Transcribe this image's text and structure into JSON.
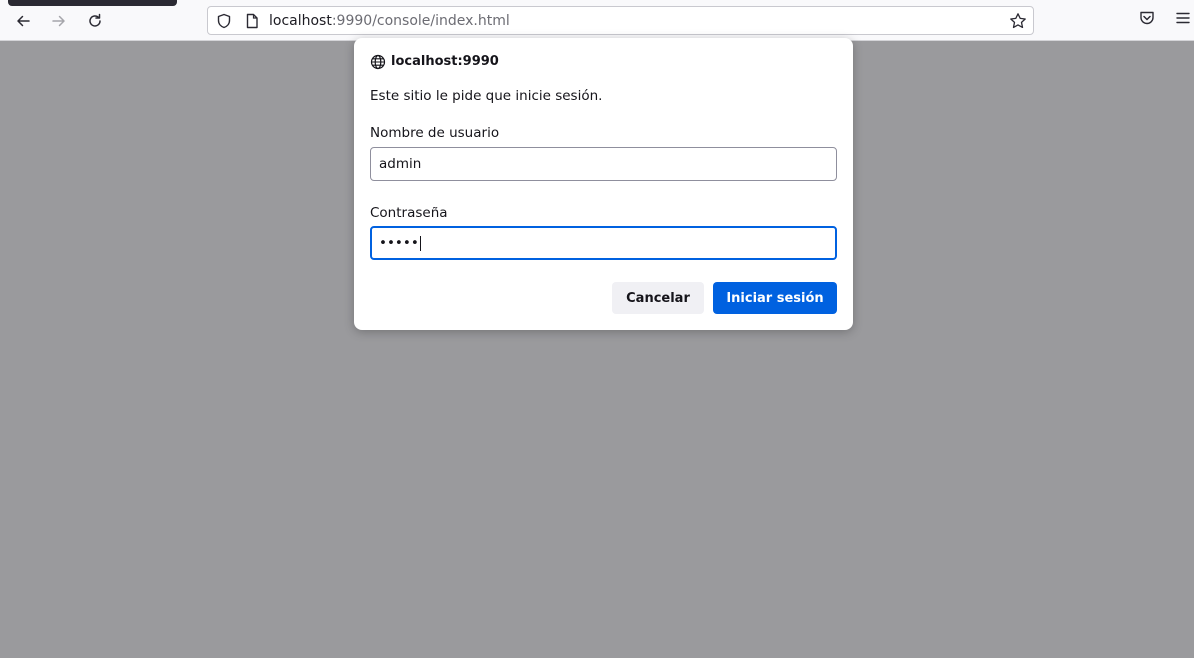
{
  "browser": {
    "url_host": "localhost",
    "url_rest": ":9990/console/index.html"
  },
  "dialog": {
    "host": "localhost:9990",
    "message": "Este sitio le pide que inicie sesión.",
    "username_label": "Nombre de usuario",
    "username_value": "admin",
    "password_label": "Contraseña",
    "password_value": "•••••",
    "cancel_label": "Cancelar",
    "login_label": "Iniciar sesión"
  },
  "colors": {
    "accent": "#0061e0",
    "backdrop": "#9a9a9d"
  },
  "icons": [
    "back-arrow-icon",
    "forward-arrow-icon",
    "reload-icon",
    "shield-icon",
    "page-icon",
    "star-icon",
    "pocket-icon",
    "menu-icon",
    "globe-icon"
  ]
}
